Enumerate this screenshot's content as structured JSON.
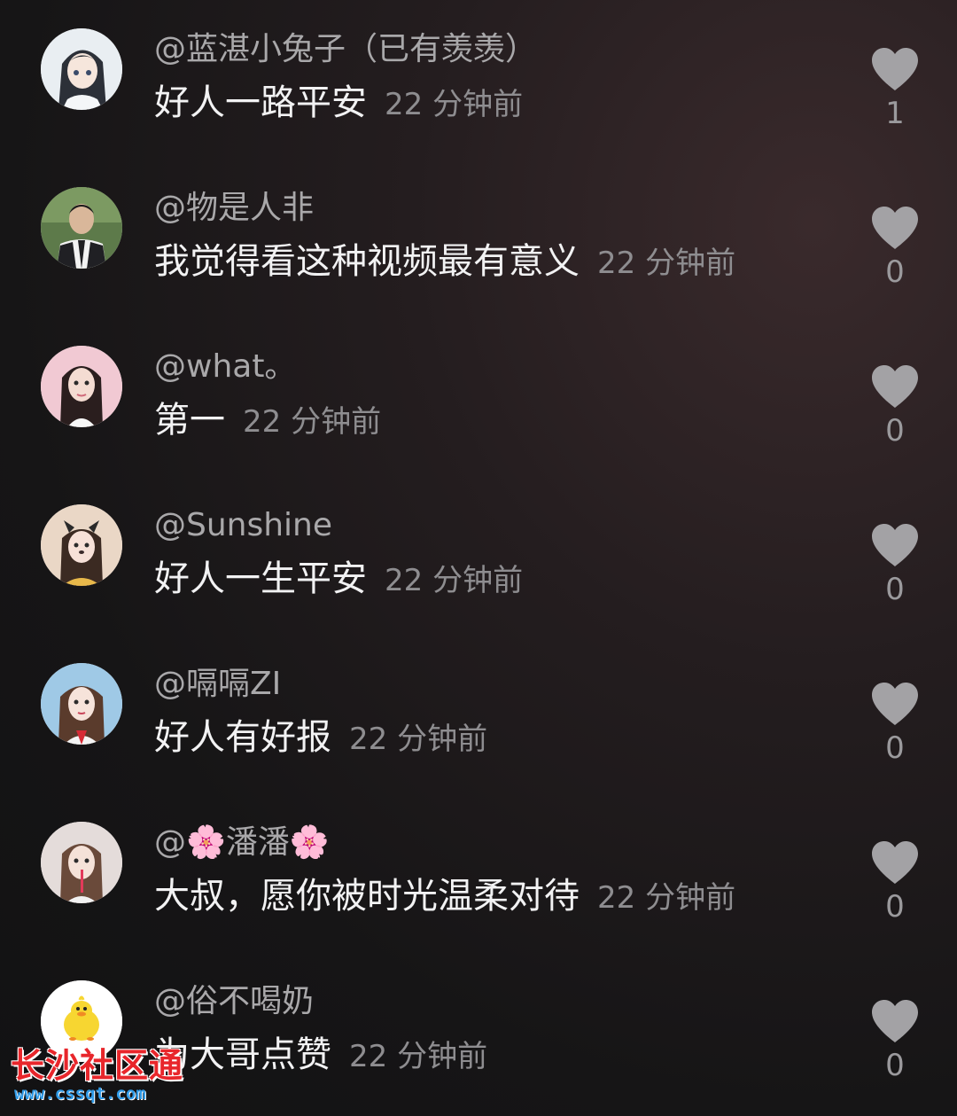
{
  "comments": [
    {
      "username": "@蓝湛小兔子（已有羡羡）",
      "text": "好人一路平安",
      "time": "22 分钟前",
      "likes": "1",
      "avatar": "anime-girl-avatar"
    },
    {
      "username": "@物是人非",
      "text": "我觉得看这种视频最有意义",
      "time": "22 分钟前",
      "likes": "0",
      "avatar": "man-in-suit-avatar"
    },
    {
      "username": "@what。",
      "text": "第一",
      "time": "22 分钟前",
      "likes": "0",
      "avatar": "girl-selfie-avatar"
    },
    {
      "username": "@Sunshine",
      "text": "好人一生平安",
      "time": "22 分钟前",
      "likes": "0",
      "avatar": "cat-ears-girl-avatar"
    },
    {
      "username": "@嗝嗝ZI",
      "text": "好人有好报",
      "time": "22 分钟前",
      "likes": "0",
      "avatar": "girl-red-top-avatar"
    },
    {
      "username": "@🌸潘潘🌸",
      "text": "大叔，愿你被时光温柔对待",
      "time": "22 分钟前",
      "likes": "0",
      "avatar": "girl-with-straw-avatar"
    },
    {
      "username": "@俗不喝奶",
      "text": "为大哥点赞",
      "time": "22 分钟前",
      "likes": "0",
      "avatar": "yellow-duck-avatar"
    }
  ],
  "watermark": {
    "title": "长沙社区通",
    "url": "www.cssqt.com"
  },
  "colors": {
    "background": "#161516",
    "username": "#a9a8aa",
    "text": "#f2f2f3",
    "timestamp": "#8e8d90",
    "heart": "#a3a2a5",
    "watermark_red": "#e8262b",
    "watermark_blue": "#2f9be8"
  }
}
